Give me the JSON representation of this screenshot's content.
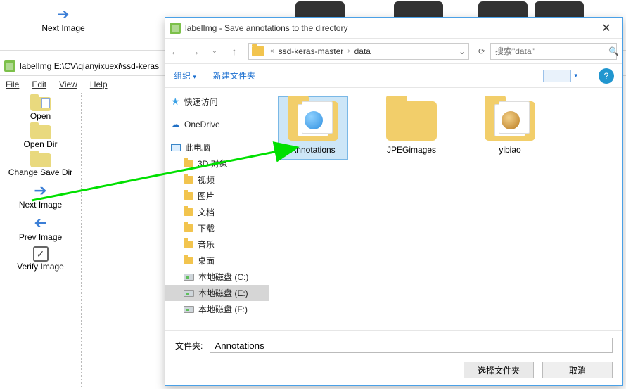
{
  "bg": {
    "next_image": "Next Image",
    "drive_label": "本地磁盘 (C:)",
    "title": "labelImg E:\\CV\\qianyixuexi\\ssd-keras",
    "menu": {
      "file": "File",
      "edit": "Edit",
      "view": "View",
      "help": "Help"
    },
    "tools": {
      "open": "Open",
      "open_dir": "Open Dir",
      "change_save_dir": "Change Save Dir",
      "next_image2": "Next Image",
      "prev_image": "Prev Image",
      "verify_image": "Verify Image"
    }
  },
  "dialog": {
    "title": "labelImg - Save annotations to the directory",
    "breadcrumb": {
      "seg1": "ssd-keras-master",
      "seg2": "data"
    },
    "search_placeholder": "搜索\"data\"",
    "toolbar": {
      "organize": "组织",
      "new_folder": "新建文件夹"
    },
    "tree": {
      "quick_access": "快速访问",
      "onedrive": "OneDrive",
      "this_pc": "此电脑",
      "obj3d": "3D 对象",
      "video": "视频",
      "pictures": "图片",
      "documents": "文档",
      "downloads": "下载",
      "music": "音乐",
      "desktop": "桌面",
      "drive_c": "本地磁盘 (C:)",
      "drive_e": "本地磁盘 (E:)",
      "drive_f": "本地磁盘 (F:)"
    },
    "files": {
      "annotations": "Annotations",
      "jpegimages": "JPEGimages",
      "yibiao": "yibiao"
    },
    "folder_label": "文件夹:",
    "folder_value": "Annotations",
    "btn_select": "选择文件夹",
    "btn_cancel": "取消"
  }
}
